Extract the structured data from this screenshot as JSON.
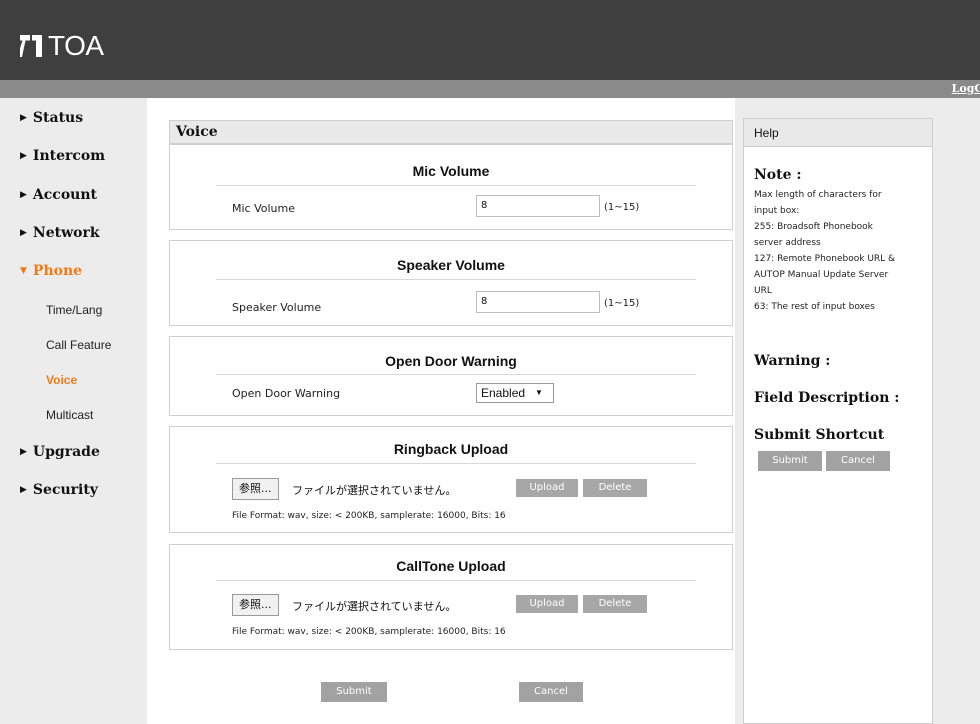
{
  "header": {
    "brand": "TOA",
    "logout": "LogO"
  },
  "sidebar": {
    "items": [
      {
        "label": "Status"
      },
      {
        "label": "Intercom"
      },
      {
        "label": "Account"
      },
      {
        "label": "Network"
      },
      {
        "label": "Phone"
      },
      {
        "label": "Upgrade"
      },
      {
        "label": "Security"
      }
    ],
    "phone_subitems": [
      {
        "label": "Time/Lang"
      },
      {
        "label": "Call Feature"
      },
      {
        "label": "Voice"
      },
      {
        "label": "Multicast"
      }
    ]
  },
  "main": {
    "title": "Voice",
    "mic": {
      "title": "Mic Volume",
      "label": "Mic Volume",
      "value": "8",
      "range": "(1~15)"
    },
    "speaker": {
      "title": "Speaker Volume",
      "label": "Speaker Volume",
      "value": "8",
      "range": "(1~15)"
    },
    "door": {
      "title": "Open Door Warning",
      "label": "Open Door Warning",
      "selected": "Enabled"
    },
    "ringback": {
      "title": "Ringback Upload",
      "browse": "参照...",
      "no_file": "ファイルが選択されていません。",
      "upload": "Upload",
      "delete": "Delete",
      "format": "File Format: wav, size: < 200KB, samplerate: 16000, Bits: 16"
    },
    "calltone": {
      "title": "CallTone Upload",
      "browse": "参照...",
      "no_file": "ファイルが選択されていません。",
      "upload": "Upload",
      "delete": "Delete",
      "format": "File Format: wav, size: < 200KB, samplerate: 16000, Bits: 16"
    },
    "submit": "Submit",
    "cancel": "Cancel"
  },
  "help": {
    "title": "Help",
    "note_heading": "Note :",
    "note_lines": [
      "Max length of characters for",
      "input box:",
      "255: Broadsoft Phonebook",
      "server address",
      "127: Remote Phonebook URL &",
      "AUTOP Manual Update Server",
      "URL",
      "63: The rest of input boxes"
    ],
    "warning_heading": "Warning :",
    "field_heading": "Field Description :",
    "shortcut_heading": "Submit Shortcut",
    "submit": "Submit",
    "cancel": "Cancel"
  },
  "colors": {
    "topbar": "#3f3f3f",
    "active": "#f07a1a",
    "button": "#a7a7a7"
  }
}
